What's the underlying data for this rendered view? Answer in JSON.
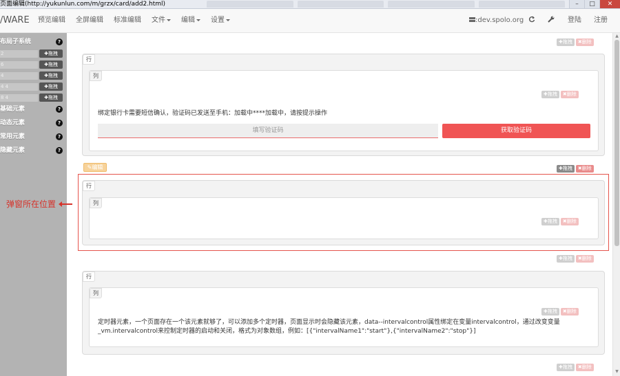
{
  "window": {
    "title": "页面编辑(http://yukunlun.com/m/grzx/card/add2.html)"
  },
  "navbar": {
    "brand": "/WARE",
    "items": [
      "预览编辑",
      "全屏编辑",
      "标准编辑",
      "文件",
      "编辑",
      "设置"
    ],
    "server": "dev.spolo.org",
    "server_icon": "server-icon",
    "refresh_icon": "refresh-icon",
    "wrench_icon": "wrench-icon",
    "login": "登陆",
    "register": "注册"
  },
  "sidebar": {
    "sections": [
      {
        "label": "布局子系统",
        "expanded": true
      },
      {
        "label": "基础元素"
      },
      {
        "label": "动态元素"
      },
      {
        "label": "常用元素"
      },
      {
        "label": "隐藏元素"
      }
    ],
    "layout_rows": [
      {
        "value": "2",
        "drag_label": "拖拽"
      },
      {
        "value": "6",
        "drag_label": "拖拽"
      },
      {
        "value": "4",
        "drag_label": "拖拽"
      },
      {
        "value": "4 4",
        "drag_label": "拖拽"
      },
      {
        "value": "8 4",
        "drag_label": "拖拽"
      }
    ]
  },
  "main": {
    "drag_label": "拖拽",
    "delete_label": "删除",
    "row_label": "行",
    "col_label": "列",
    "edit_label": "编辑",
    "sms_notice": "绑定银行卡需要短信确认，验证码已发送至手机：加载中****加载中，请按提示操作",
    "code_placeholder": "填写验证码",
    "get_code_button": "获取验证码",
    "popup_callout": "弹窗所在位置",
    "timer_desc_line1": "定时器元素，一个页面存在一个该元素就够了，可以添加多个定时器，页面显示时会隐藏该元素，data--intervalcontrol属性绑定在变量intervalcontrol，通过改变变量",
    "timer_desc_line2": "_vm.intervalcontrol来控制定时器的启动和关闭，格式为对象数组，例如：[{\"intervalName1\":\"start\"},{\"intervalName2\":\"stop\"}]"
  }
}
